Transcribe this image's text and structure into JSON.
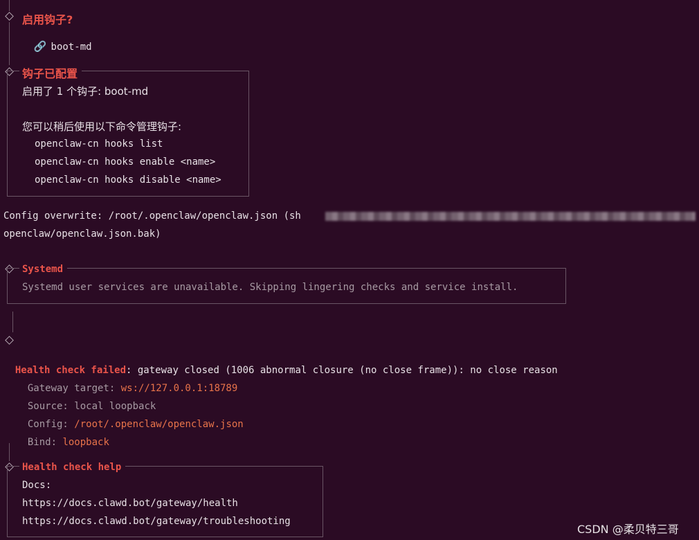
{
  "hooks_prompt": {
    "title": "启用钩子?",
    "link_icon": "🔗",
    "value": "boot-md"
  },
  "hooks_configured": {
    "title": "钩子已配置",
    "enabled_line": "启用了 1 个钩子: boot-md",
    "manage_line": "您可以稍后使用以下命令管理钩子:",
    "commands": [
      "openclaw-cn hooks list",
      "openclaw-cn hooks enable <name>",
      "openclaw-cn hooks disable <name>"
    ]
  },
  "config_overwrite": {
    "line1": "Config overwrite: /root/.openclaw/openclaw.json (sh",
    "line2": "openclaw/openclaw.json.bak)"
  },
  "systemd": {
    "title": "Systemd",
    "message": "Systemd user services are unavailable. Skipping lingering checks and service install."
  },
  "health_failed": {
    "label": "Health check failed",
    "message": ": gateway closed (1006 abnormal closure (no close frame)): no close reason",
    "details": [
      {
        "key": "Gateway target: ",
        "value": "ws://127.0.0.1:18789",
        "value_style": "orange"
      },
      {
        "key": "Source: ",
        "value": "local loopback",
        "value_style": "dim"
      },
      {
        "key": "Config: ",
        "value": "/root/.openclaw/openclaw.json",
        "value_style": "orange"
      },
      {
        "key": "Bind: ",
        "value": "loopback",
        "value_style": "orange"
      }
    ]
  },
  "health_help": {
    "title": "Health check help",
    "docs_label": "Docs:",
    "links": [
      "https://docs.clawd.bot/gateway/health",
      "https://docs.clawd.bot/gateway/troubleshooting"
    ]
  },
  "watermark": "CSDN @柔贝特三哥",
  "colors": {
    "background": "#2b0b24",
    "accent_red": "#e9544a",
    "accent_orange": "#e8734a",
    "text": "#d9d1d6",
    "dim": "#a79aa3",
    "border": "#6a5565"
  }
}
